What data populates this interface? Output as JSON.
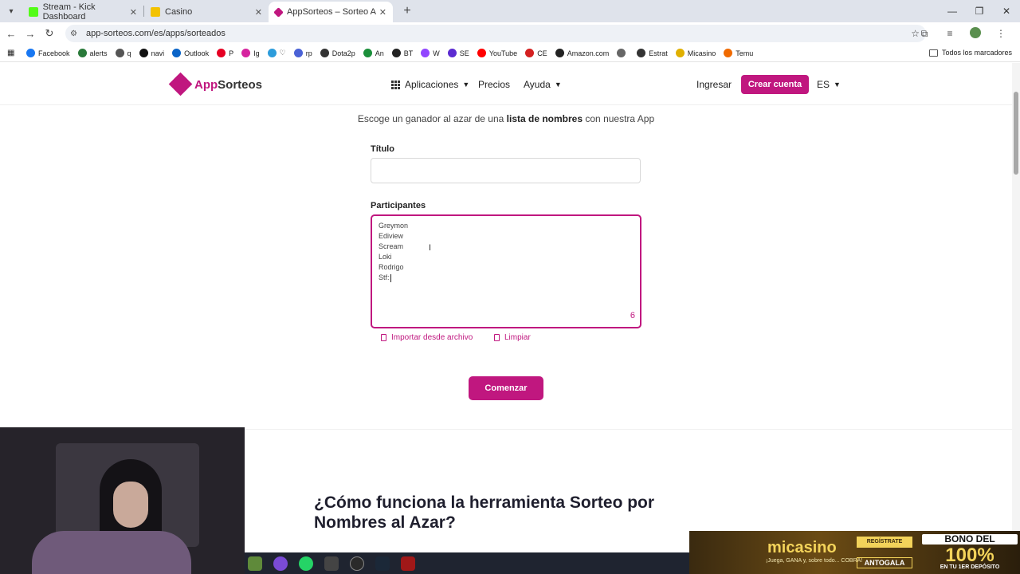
{
  "browser": {
    "tabs": [
      {
        "label": "Stream - Kick Dashboard",
        "favicon_color": "#53fc18",
        "active": false
      },
      {
        "label": "Casino",
        "favicon_color": "#f3c200",
        "active": false
      },
      {
        "label": "AppSorteos – Sorteo Aleatorio",
        "favicon_color": "#c0177f",
        "active": true
      }
    ],
    "url": "app-sorteos.com/es/apps/sorteados",
    "bookmarks": [
      {
        "label": "Facebook",
        "color": "#1877f2"
      },
      {
        "label": "alerts",
        "color": "#2a7a3a"
      },
      {
        "label": "q",
        "color": "#555555"
      },
      {
        "label": "navi",
        "color": "#111111"
      },
      {
        "label": "Outlook",
        "color": "#0a64c8"
      },
      {
        "label": "P",
        "color": "#e60023"
      },
      {
        "label": "Ig",
        "color": "#d6249f"
      },
      {
        "label": "♡",
        "color": "#2d9cdb"
      },
      {
        "label": "rp",
        "color": "#4a62d6"
      },
      {
        "label": "Dota2p",
        "color": "#333333"
      },
      {
        "label": "An",
        "color": "#1b8f3a"
      },
      {
        "label": "BT",
        "color": "#222222"
      },
      {
        "label": "W",
        "color": "#9146ff"
      },
      {
        "label": "SE",
        "color": "#5b2bd1"
      },
      {
        "label": "YouTube",
        "color": "#ff0000"
      },
      {
        "label": "CE",
        "color": "#d42020"
      },
      {
        "label": "Amazon.com",
        "color": "#222222"
      },
      {
        "label": "",
        "color": "#666666"
      },
      {
        "label": "Estrat",
        "color": "#333333"
      },
      {
        "label": "Micasino",
        "color": "#e0b000"
      },
      {
        "label": "Temu",
        "color": "#f06a00"
      }
    ],
    "all_bookmarks_label": "Todos los marcadores"
  },
  "site": {
    "logo_app": "App",
    "logo_sorteos": "Sorteos",
    "nav": {
      "aplicaciones": "Aplicaciones",
      "precios": "Precios",
      "ayuda": "Ayuda",
      "ingresar": "Ingresar",
      "crear_cuenta": "Crear cuenta",
      "lang": "ES"
    },
    "accent_color": "#c0177f"
  },
  "form": {
    "subtitle_pre": "Escoge un ganador al azar de una ",
    "subtitle_bold": "lista de nombres",
    "subtitle_post": " con nuestra App",
    "titulo_label": "Título",
    "titulo_value": "",
    "participantes_label": "Participantes",
    "participants": [
      "Greymon",
      "Ediview",
      "Scream",
      "Loki",
      "Rodrigo",
      "Stf:"
    ],
    "count": "6",
    "import_label": "Importar desde archivo",
    "clear_label": "Limpiar",
    "start_label": "Comenzar"
  },
  "section": {
    "heading_line1": "¿Cómo funciona la herramienta Sorteo por",
    "heading_line2": "Nombres al Azar?"
  },
  "banner": {
    "brand": "micasino",
    "tagline": "¡Juega, GANA y, sobre todo... COBRA!",
    "register": "REGÍSTRATE",
    "code": "ANTOGALA",
    "bono": "BONO DEL",
    "percent": "100%",
    "deposit": "EN TU 1ER DEPÓSITO"
  }
}
